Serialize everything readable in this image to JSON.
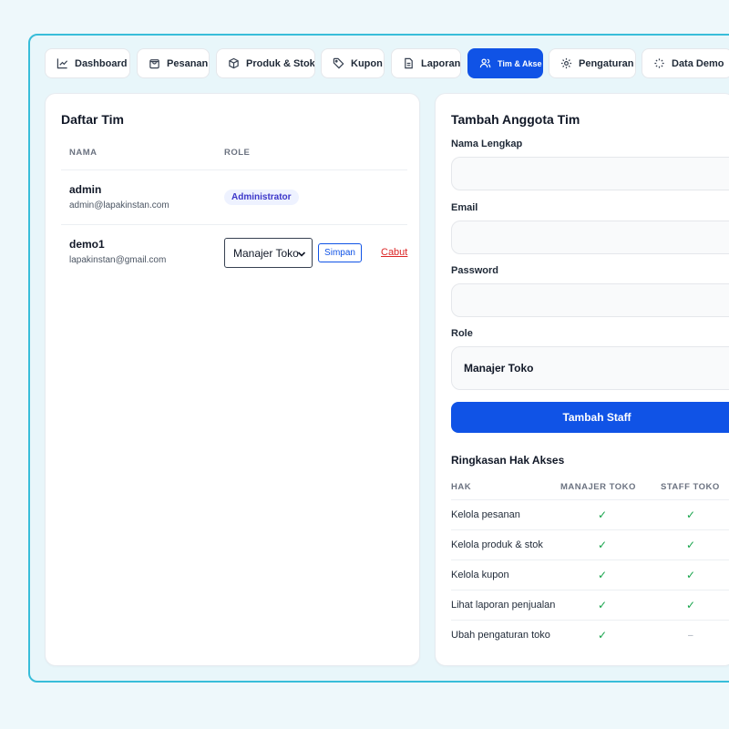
{
  "tabs": [
    {
      "label": "Dashboard",
      "icon": "chart-line-icon"
    },
    {
      "label": "Pesanan",
      "icon": "shopping-bag-icon"
    },
    {
      "label": "Produk & Stok",
      "icon": "box-icon"
    },
    {
      "label": "Kupon",
      "icon": "tag-icon"
    },
    {
      "label": "Laporan",
      "icon": "document-icon"
    },
    {
      "label": "Tim & Akses",
      "icon": "users-icon",
      "active": true
    },
    {
      "label": "Pengaturan",
      "icon": "gear-icon"
    },
    {
      "label": "Data Demo",
      "icon": "loader-icon"
    }
  ],
  "team": {
    "title": "Daftar Tim",
    "columns": [
      "NAMA",
      "ROLE"
    ],
    "members": [
      {
        "name": "admin",
        "email": "admin@lapakinstan.com",
        "role_badge": "Administrator"
      },
      {
        "name": "demo1",
        "email": "lapakinstan@gmail.com",
        "role_select": "Manajer Toko",
        "save_label": "Simpan",
        "revoke_label": "Cabut"
      }
    ]
  },
  "form": {
    "title": "Tambah Anggota Tim",
    "name_label": "Nama Lengkap",
    "email_label": "Email",
    "password_label": "Password",
    "role_label": "Role",
    "role_value": "Manajer Toko",
    "submit_label": "Tambah Staff"
  },
  "access": {
    "title": "Ringkasan Hak Akses",
    "columns": [
      "HAK",
      "MANAJER TOKO",
      "STAFF TOKO"
    ],
    "rows": [
      {
        "label": "Kelola pesanan",
        "manager": "✓",
        "staff": "✓"
      },
      {
        "label": "Kelola produk & stok",
        "manager": "✓",
        "staff": "✓"
      },
      {
        "label": "Kelola kupon",
        "manager": "✓",
        "staff": "✓"
      },
      {
        "label": "Lihat laporan penjualan",
        "manager": "✓",
        "staff": "✓"
      },
      {
        "label": "Ubah pengaturan toko",
        "manager": "✓",
        "staff": "–"
      }
    ]
  },
  "colors": {
    "accent": "#1053e6",
    "frame": "#38bdd9",
    "check": "#16a34a",
    "danger": "#dc2626"
  }
}
